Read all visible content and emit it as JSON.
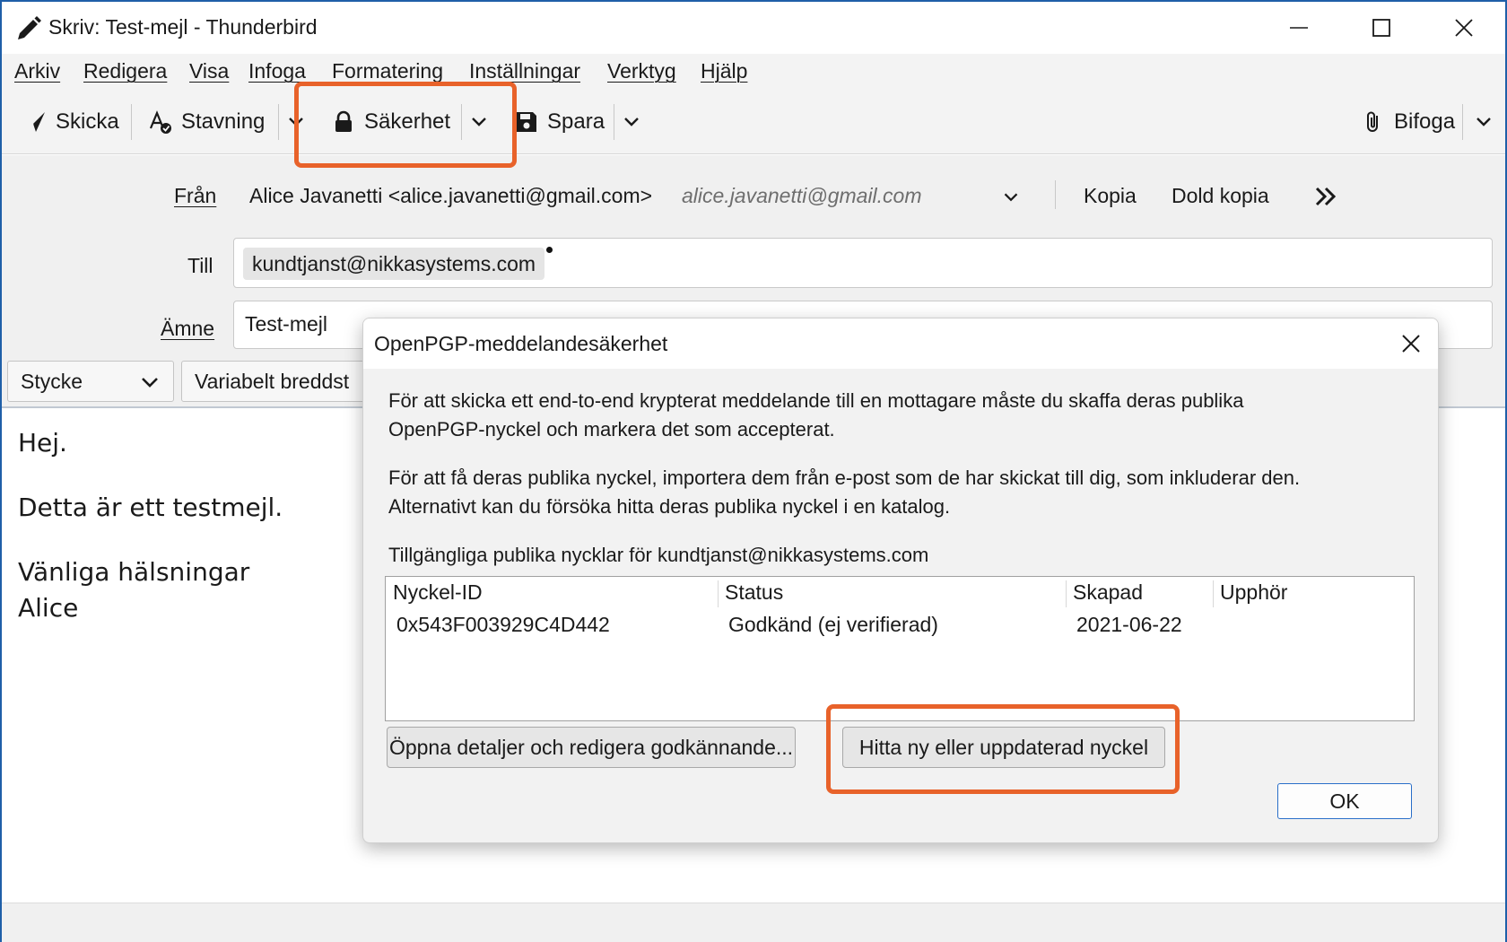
{
  "window": {
    "title": "Skriv: Test-mejl - Thunderbird"
  },
  "menu": [
    "Arkiv",
    "Redigera",
    "Visa",
    "Infoga",
    "Formatering",
    "Inställningar",
    "Verktyg",
    "Hjälp"
  ],
  "toolbar": {
    "send": "Skicka",
    "spelling": "Stavning",
    "security": "Säkerhet",
    "save": "Spara",
    "attach": "Bifoga"
  },
  "header": {
    "from_label": "Från",
    "from_value": "Alice Javanetti <alice.javanetti@gmail.com>",
    "from_identity": "alice.javanetti@gmail.com",
    "cc": "Kopia",
    "bcc": "Dold kopia",
    "to_label": "Till",
    "to_value": "kundtjanst@nikkasystems.com",
    "subject_label": "Ämne",
    "subject_value": "Test-mejl"
  },
  "format": {
    "paragraph": "Stycke",
    "font": "Variabelt breddst"
  },
  "body": {
    "line1": "Hej.",
    "line2": "Detta är ett testmejl.",
    "line3": "Vänliga hälsningar",
    "line4": "Alice"
  },
  "dialog": {
    "title": "OpenPGP-meddelandesäkerhet",
    "para1_a": "För att skicka ett end-to-end krypterat meddelande till en mottagare måste du skaffa deras publika",
    "para1_b": "OpenPGP-nyckel och markera det som accepterat.",
    "para2_a": "För att få deras publika nyckel, importera dem från e-post som de har skickat till dig, som inkluderar den.",
    "para2_b": "Alternativt kan du försöka hitta deras publika nyckel i en katalog.",
    "keys_label": "Tillgängliga publika nycklar för kundtjanst@nikkasystems.com",
    "columns": [
      "Nyckel-ID",
      "Status",
      "Skapad",
      "Upphör"
    ],
    "rows": [
      [
        "0x543F003929C4D442",
        "Godkänd (ej verifierad)",
        "2021-06-22",
        ""
      ]
    ],
    "details_button": "Öppna detaljer och redigera godkännande...",
    "find_button": "Hitta ny eller uppdaterad nyckel",
    "ok_button": "OK"
  },
  "colors": {
    "highlight": "#e8622a",
    "window_border": "#1f5fa8",
    "ok_border": "#2a6fc9"
  }
}
